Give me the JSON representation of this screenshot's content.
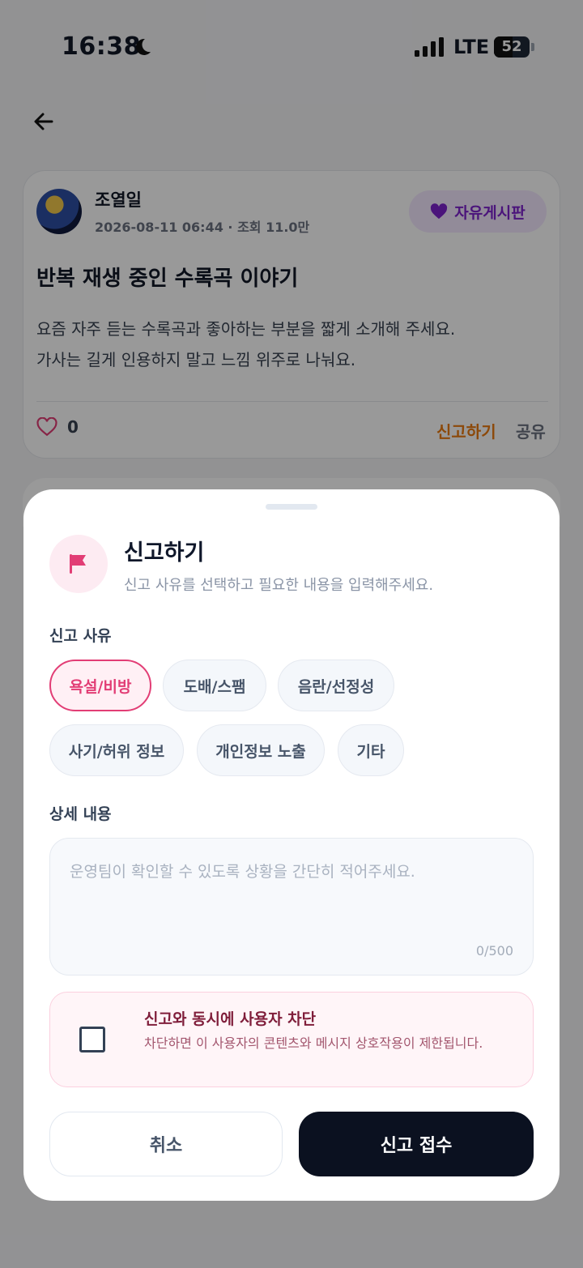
{
  "status_bar": {
    "time": "16:38",
    "network": "LTE",
    "battery": "52",
    "battery_level_percent": 52
  },
  "post": {
    "author": "조열일",
    "meta": "2026-08-11 06:44 · 조회 11.0만",
    "board": "자유게시판",
    "title": "반복 재생 중인 수록곡 이야기",
    "body_line1": "요즘 자주 듣는 수록곡과 좋아하는 부분을 짧게 소개해 주세요.",
    "body_line2": "가사는 길게 인용하지 말고 느낌 위주로 나눠요.",
    "like_count": "0",
    "report_label": "신고하기",
    "share_label": "공유"
  },
  "report_sheet": {
    "title": "신고하기",
    "subtitle": "신고 사유를 선택하고 필요한 내용을 입력해주세요.",
    "reason_label": "신고 사유",
    "reasons": [
      "욕설/비방",
      "도배/스팸",
      "음란/선정성",
      "사기/허위 정보",
      "개인정보 노출",
      "기타"
    ],
    "selected_reason": "욕설/비방",
    "detail_label": "상세 내용",
    "detail_placeholder": "운영팀이 확인할 수 있도록 상황을 간단히 적어주세요.",
    "detail_counter": "0/500",
    "block_title": "신고와 동시에 사용자 차단",
    "block_desc": "차단하면 이 사용자의 콘텐츠와 메시지 상호작용이 제한됩니다.",
    "block_checked": false,
    "cancel_label": "취소",
    "submit_label": "신고 접수"
  },
  "colors": {
    "accent_pink": "#e23d75",
    "report_orange": "#ea7a12",
    "submit_dark": "#0b1120"
  }
}
